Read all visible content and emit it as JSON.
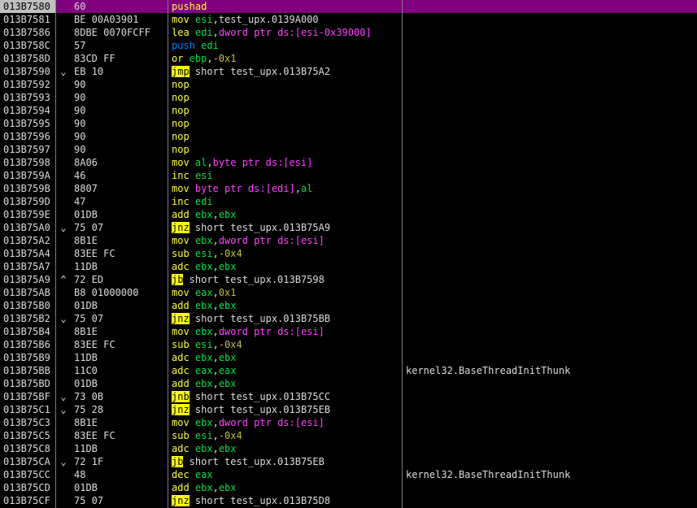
{
  "colors": {
    "selection_bg": "#800080",
    "default_text": "#dcdcdc",
    "comment": "#dcdcdc"
  },
  "tokens": {
    "mnemonic": {
      "color": "#ffff40"
    },
    "push": {
      "color": "#0080ff"
    },
    "jump": {
      "color": "#000000",
      "bg": "#ffff00"
    },
    "operand": {
      "color": "#dcdcdc"
    },
    "register": {
      "color": "#00e040"
    },
    "keyword": {
      "color": "#ff40ff"
    },
    "number": {
      "color": "#c0c040"
    },
    "punct": {
      "color": "#dcdcdc"
    }
  },
  "rows": [
    {
      "addr": "013B7580",
      "jump_arrow": "",
      "bytes": "60",
      "selected": true,
      "comment": "",
      "asm": [
        {
          "t": "pushad",
          "k": "mnemonic"
        }
      ]
    },
    {
      "addr": "013B7581",
      "jump_arrow": "",
      "bytes": "BE 00A03901",
      "selected": false,
      "comment": "",
      "asm": [
        {
          "t": "mov ",
          "k": "mnemonic"
        },
        {
          "t": "esi",
          "k": "register"
        },
        {
          "t": ",test_upx.0139A000",
          "k": "operand"
        }
      ]
    },
    {
      "addr": "013B7586",
      "jump_arrow": "",
      "bytes": "8DBE 0070FCFF",
      "selected": false,
      "comment": "",
      "asm": [
        {
          "t": "lea ",
          "k": "mnemonic"
        },
        {
          "t": "edi",
          "k": "register"
        },
        {
          "t": ",",
          "k": "punct"
        },
        {
          "t": "dword ptr ds:[esi-0x39000]",
          "k": "keyword"
        }
      ]
    },
    {
      "addr": "013B758C",
      "jump_arrow": "",
      "bytes": "57",
      "selected": false,
      "comment": "",
      "asm": [
        {
          "t": "push ",
          "k": "push"
        },
        {
          "t": "edi",
          "k": "register"
        }
      ]
    },
    {
      "addr": "013B758D",
      "jump_arrow": "",
      "bytes": "83CD FF",
      "selected": false,
      "comment": "",
      "asm": [
        {
          "t": "or ",
          "k": "mnemonic"
        },
        {
          "t": "ebp",
          "k": "register"
        },
        {
          "t": ",",
          "k": "punct"
        },
        {
          "t": "-0x1",
          "k": "number"
        }
      ]
    },
    {
      "addr": "013B7590",
      "jump_arrow": "⌄",
      "bytes": "EB 10",
      "selected": false,
      "comment": "",
      "asm": [
        {
          "t": "jmp",
          "k": "jump"
        },
        {
          "t": " short test_upx.013B75A2",
          "k": "operand"
        }
      ]
    },
    {
      "addr": "013B7592",
      "jump_arrow": "",
      "bytes": "90",
      "selected": false,
      "comment": "",
      "asm": [
        {
          "t": "nop",
          "k": "mnemonic"
        }
      ]
    },
    {
      "addr": "013B7593",
      "jump_arrow": "",
      "bytes": "90",
      "selected": false,
      "comment": "",
      "asm": [
        {
          "t": "nop",
          "k": "mnemonic"
        }
      ]
    },
    {
      "addr": "013B7594",
      "jump_arrow": "",
      "bytes": "90",
      "selected": false,
      "comment": "",
      "asm": [
        {
          "t": "nop",
          "k": "mnemonic"
        }
      ]
    },
    {
      "addr": "013B7595",
      "jump_arrow": "",
      "bytes": "90",
      "selected": false,
      "comment": "",
      "asm": [
        {
          "t": "nop",
          "k": "mnemonic"
        }
      ]
    },
    {
      "addr": "013B7596",
      "jump_arrow": "",
      "bytes": "90",
      "selected": false,
      "comment": "",
      "asm": [
        {
          "t": "nop",
          "k": "mnemonic"
        }
      ]
    },
    {
      "addr": "013B7597",
      "jump_arrow": "",
      "bytes": "90",
      "selected": false,
      "comment": "",
      "asm": [
        {
          "t": "nop",
          "k": "mnemonic"
        }
      ]
    },
    {
      "addr": "013B7598",
      "jump_arrow": "",
      "bytes": "8A06",
      "selected": false,
      "comment": "",
      "asm": [
        {
          "t": "mov ",
          "k": "mnemonic"
        },
        {
          "t": "al",
          "k": "register"
        },
        {
          "t": ",",
          "k": "punct"
        },
        {
          "t": "byte ptr ds:[esi]",
          "k": "keyword"
        }
      ]
    },
    {
      "addr": "013B759A",
      "jump_arrow": "",
      "bytes": "46",
      "selected": false,
      "comment": "",
      "asm": [
        {
          "t": "inc ",
          "k": "mnemonic"
        },
        {
          "t": "esi",
          "k": "register"
        }
      ]
    },
    {
      "addr": "013B759B",
      "jump_arrow": "",
      "bytes": "8807",
      "selected": false,
      "comment": "",
      "asm": [
        {
          "t": "mov ",
          "k": "mnemonic"
        },
        {
          "t": "byte ptr ds:[edi]",
          "k": "keyword"
        },
        {
          "t": ",",
          "k": "punct"
        },
        {
          "t": "al",
          "k": "register"
        }
      ]
    },
    {
      "addr": "013B759D",
      "jump_arrow": "",
      "bytes": "47",
      "selected": false,
      "comment": "",
      "asm": [
        {
          "t": "inc ",
          "k": "mnemonic"
        },
        {
          "t": "edi",
          "k": "register"
        }
      ]
    },
    {
      "addr": "013B759E",
      "jump_arrow": "",
      "bytes": "01DB",
      "selected": false,
      "comment": "",
      "asm": [
        {
          "t": "add ",
          "k": "mnemonic"
        },
        {
          "t": "ebx",
          "k": "register"
        },
        {
          "t": ",",
          "k": "punct"
        },
        {
          "t": "ebx",
          "k": "register"
        }
      ]
    },
    {
      "addr": "013B75A0",
      "jump_arrow": "⌄",
      "bytes": "75 07",
      "selected": false,
      "comment": "",
      "asm": [
        {
          "t": "jnz",
          "k": "jump"
        },
        {
          "t": " short test_upx.013B75A9",
          "k": "operand"
        }
      ]
    },
    {
      "addr": "013B75A2",
      "jump_arrow": "",
      "bytes": "8B1E",
      "selected": false,
      "comment": "",
      "asm": [
        {
          "t": "mov ",
          "k": "mnemonic"
        },
        {
          "t": "ebx",
          "k": "register"
        },
        {
          "t": ",",
          "k": "punct"
        },
        {
          "t": "dword ptr ds:[esi]",
          "k": "keyword"
        }
      ]
    },
    {
      "addr": "013B75A4",
      "jump_arrow": "",
      "bytes": "83EE FC",
      "selected": false,
      "comment": "",
      "asm": [
        {
          "t": "sub ",
          "k": "mnemonic"
        },
        {
          "t": "esi",
          "k": "register"
        },
        {
          "t": ",",
          "k": "punct"
        },
        {
          "t": "-0x4",
          "k": "number"
        }
      ]
    },
    {
      "addr": "013B75A7",
      "jump_arrow": "",
      "bytes": "11DB",
      "selected": false,
      "comment": "",
      "asm": [
        {
          "t": "adc ",
          "k": "mnemonic"
        },
        {
          "t": "ebx",
          "k": "register"
        },
        {
          "t": ",",
          "k": "punct"
        },
        {
          "t": "ebx",
          "k": "register"
        }
      ]
    },
    {
      "addr": "013B75A9",
      "jump_arrow": "^",
      "bytes": "72 ED",
      "selected": false,
      "comment": "",
      "asm": [
        {
          "t": "jb",
          "k": "jump"
        },
        {
          "t": " short test_upx.013B7598",
          "k": "operand"
        }
      ]
    },
    {
      "addr": "013B75AB",
      "jump_arrow": "",
      "bytes": "B8 01000000",
      "selected": false,
      "comment": "",
      "asm": [
        {
          "t": "mov ",
          "k": "mnemonic"
        },
        {
          "t": "eax",
          "k": "register"
        },
        {
          "t": ",",
          "k": "punct"
        },
        {
          "t": "0x1",
          "k": "number"
        }
      ]
    },
    {
      "addr": "013B75B0",
      "jump_arrow": "",
      "bytes": "01DB",
      "selected": false,
      "comment": "",
      "asm": [
        {
          "t": "add ",
          "k": "mnemonic"
        },
        {
          "t": "ebx",
          "k": "register"
        },
        {
          "t": ",",
          "k": "punct"
        },
        {
          "t": "ebx",
          "k": "register"
        }
      ]
    },
    {
      "addr": "013B75B2",
      "jump_arrow": "⌄",
      "bytes": "75 07",
      "selected": false,
      "comment": "",
      "asm": [
        {
          "t": "jnz",
          "k": "jump"
        },
        {
          "t": " short test_upx.013B75BB",
          "k": "operand"
        }
      ]
    },
    {
      "addr": "013B75B4",
      "jump_arrow": "",
      "bytes": "8B1E",
      "selected": false,
      "comment": "",
      "asm": [
        {
          "t": "mov ",
          "k": "mnemonic"
        },
        {
          "t": "ebx",
          "k": "register"
        },
        {
          "t": ",",
          "k": "punct"
        },
        {
          "t": "dword ptr ds:[esi]",
          "k": "keyword"
        }
      ]
    },
    {
      "addr": "013B75B6",
      "jump_arrow": "",
      "bytes": "83EE FC",
      "selected": false,
      "comment": "",
      "asm": [
        {
          "t": "sub ",
          "k": "mnemonic"
        },
        {
          "t": "esi",
          "k": "register"
        },
        {
          "t": ",",
          "k": "punct"
        },
        {
          "t": "-0x4",
          "k": "number"
        }
      ]
    },
    {
      "addr": "013B75B9",
      "jump_arrow": "",
      "bytes": "11DB",
      "selected": false,
      "comment": "",
      "asm": [
        {
          "t": "adc ",
          "k": "mnemonic"
        },
        {
          "t": "ebx",
          "k": "register"
        },
        {
          "t": ",",
          "k": "punct"
        },
        {
          "t": "ebx",
          "k": "register"
        }
      ]
    },
    {
      "addr": "013B75BB",
      "jump_arrow": "",
      "bytes": "11C0",
      "selected": false,
      "comment": "kernel32.BaseThreadInitThunk",
      "asm": [
        {
          "t": "adc ",
          "k": "mnemonic"
        },
        {
          "t": "eax",
          "k": "register"
        },
        {
          "t": ",",
          "k": "punct"
        },
        {
          "t": "eax",
          "k": "register"
        }
      ]
    },
    {
      "addr": "013B75BD",
      "jump_arrow": "",
      "bytes": "01DB",
      "selected": false,
      "comment": "",
      "asm": [
        {
          "t": "add ",
          "k": "mnemonic"
        },
        {
          "t": "ebx",
          "k": "register"
        },
        {
          "t": ",",
          "k": "punct"
        },
        {
          "t": "ebx",
          "k": "register"
        }
      ]
    },
    {
      "addr": "013B75BF",
      "jump_arrow": "⌄",
      "bytes": "73 0B",
      "selected": false,
      "comment": "",
      "asm": [
        {
          "t": "jnb",
          "k": "jump"
        },
        {
          "t": " short test_upx.013B75CC",
          "k": "operand"
        }
      ]
    },
    {
      "addr": "013B75C1",
      "jump_arrow": "⌄",
      "bytes": "75 28",
      "selected": false,
      "comment": "",
      "asm": [
        {
          "t": "jnz",
          "k": "jump"
        },
        {
          "t": " short test_upx.013B75EB",
          "k": "operand"
        }
      ]
    },
    {
      "addr": "013B75C3",
      "jump_arrow": "",
      "bytes": "8B1E",
      "selected": false,
      "comment": "",
      "asm": [
        {
          "t": "mov ",
          "k": "mnemonic"
        },
        {
          "t": "ebx",
          "k": "register"
        },
        {
          "t": ",",
          "k": "punct"
        },
        {
          "t": "dword ptr ds:[esi]",
          "k": "keyword"
        }
      ]
    },
    {
      "addr": "013B75C5",
      "jump_arrow": "",
      "bytes": "83EE FC",
      "selected": false,
      "comment": "",
      "asm": [
        {
          "t": "sub ",
          "k": "mnemonic"
        },
        {
          "t": "esi",
          "k": "register"
        },
        {
          "t": ",",
          "k": "punct"
        },
        {
          "t": "-0x4",
          "k": "number"
        }
      ]
    },
    {
      "addr": "013B75C8",
      "jump_arrow": "",
      "bytes": "11DB",
      "selected": false,
      "comment": "",
      "asm": [
        {
          "t": "adc ",
          "k": "mnemonic"
        },
        {
          "t": "ebx",
          "k": "register"
        },
        {
          "t": ",",
          "k": "punct"
        },
        {
          "t": "ebx",
          "k": "register"
        }
      ]
    },
    {
      "addr": "013B75CA",
      "jump_arrow": "⌄",
      "bytes": "72 1F",
      "selected": false,
      "comment": "",
      "asm": [
        {
          "t": "jb",
          "k": "jump"
        },
        {
          "t": " short test_upx.013B75EB",
          "k": "operand"
        }
      ]
    },
    {
      "addr": "013B75CC",
      "jump_arrow": "",
      "bytes": "48",
      "selected": false,
      "comment": "kernel32.BaseThreadInitThunk",
      "asm": [
        {
          "t": "dec ",
          "k": "mnemonic"
        },
        {
          "t": "eax",
          "k": "register"
        }
      ]
    },
    {
      "addr": "013B75CD",
      "jump_arrow": "",
      "bytes": "01DB",
      "selected": false,
      "comment": "",
      "asm": [
        {
          "t": "add ",
          "k": "mnemonic"
        },
        {
          "t": "ebx",
          "k": "register"
        },
        {
          "t": ",",
          "k": "punct"
        },
        {
          "t": "ebx",
          "k": "register"
        }
      ]
    },
    {
      "addr": "013B75CF",
      "jump_arrow": "",
      "bytes": "75 07",
      "selected": false,
      "comment": "",
      "asm": [
        {
          "t": "jnz",
          "k": "jump"
        },
        {
          "t": " short test_upx.013B75D8",
          "k": "operand"
        }
      ]
    }
  ]
}
